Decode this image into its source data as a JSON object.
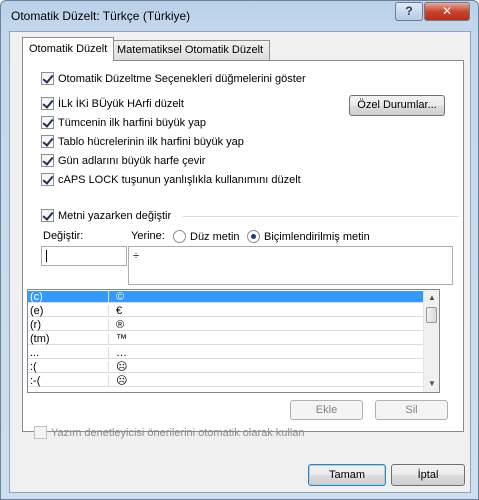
{
  "window": {
    "title": "Otomatik Düzelt: Türkçe (Türkiye)",
    "help_label": "?",
    "close_label": "✕"
  },
  "tabs": [
    {
      "label": "Otomatik Düzelt",
      "active": true
    },
    {
      "label": "Matematiksel Otomatik Düzelt",
      "active": false
    }
  ],
  "options": {
    "show_buttons": "Otomatik Düzeltme Seçenekleri düğmelerini göster",
    "two_initials": "İLk İKi BÜyük HArfi düzelt",
    "sentence_first": "Tümcenin ilk harfini büyük yap",
    "table_first": "Tablo hücrelerinin ilk harfini büyük yap",
    "day_names": "Gün adlarını büyük harfe çevir",
    "caps_lock": "cAPS LOCK tuşunun yanlışlıkla kullanımını düzelt"
  },
  "exceptions_button": "Özel Durumlar...",
  "replace_section": {
    "toggle_label": "Metni yazarken değiştir",
    "replace_label": "Değiştir:",
    "with_label": "Yerine:",
    "plain_text_label": "Düz metin",
    "formatted_text_label": "Biçimlendirilmiş metin",
    "replace_value": "",
    "with_value": "÷"
  },
  "entries": [
    {
      "from": "(c)",
      "to": "©",
      "selected": true
    },
    {
      "from": "(e)",
      "to": "€",
      "selected": false
    },
    {
      "from": "(r)",
      "to": "®",
      "selected": false
    },
    {
      "from": "(tm)",
      "to": "™",
      "selected": false
    },
    {
      "from": "...",
      "to": "…",
      "selected": false
    },
    {
      "from": ":(",
      "to": "☹",
      "selected": false
    },
    {
      "from": ":-(",
      "to": "☹",
      "selected": false
    }
  ],
  "buttons": {
    "add": "Ekle",
    "delete": "Sil",
    "ok": "Tamam",
    "cancel": "İptal"
  },
  "spelling_suggestions": "Yazım denetleyicisi önerilerini otomatik olarak kullan",
  "colors": {
    "selection": "#3399ff",
    "accent": "#3c7fb1"
  }
}
